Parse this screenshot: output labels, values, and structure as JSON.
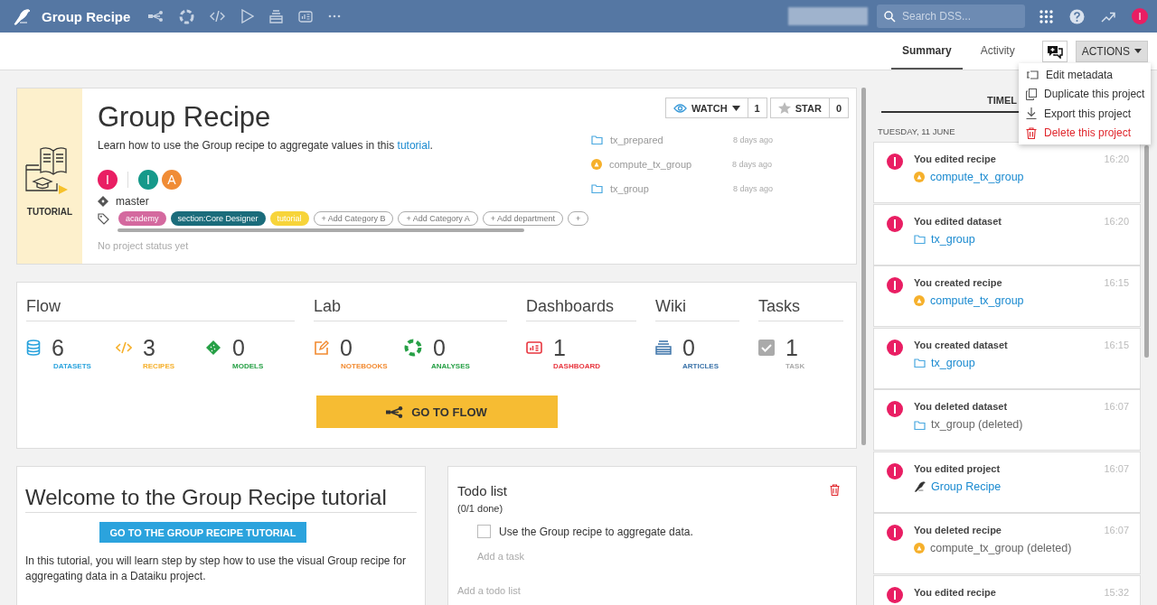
{
  "topbar": {
    "title": "Group Recipe",
    "search": {
      "placeholder": "Search DSS..."
    },
    "avatar": {
      "initial": "I",
      "color": "#e91e63"
    }
  },
  "tabs": [
    {
      "label": "Summary",
      "selected": true
    },
    {
      "label": "Activity",
      "selected": false
    }
  ],
  "actions_button": "ACTIONS",
  "actions_menu": [
    {
      "label": "Edit metadata",
      "kind": "normal"
    },
    {
      "label": "Duplicate this project",
      "kind": "normal"
    },
    {
      "label": "Export this project",
      "kind": "normal"
    },
    {
      "label": "Delete this project",
      "kind": "danger"
    }
  ],
  "project": {
    "badge": "TUTORIAL",
    "title": "Group Recipe",
    "description_before": "Learn how to use the Group recipe to aggregate values in this ",
    "description_link": "tutorial",
    "description_after": ".",
    "owner": {
      "initial": "I",
      "color": "#e91e63"
    },
    "contributors": [
      {
        "initial": "I",
        "color": "#16998a"
      },
      {
        "initial": "A",
        "color": "#f08c36"
      }
    ],
    "branch": "master",
    "tags": [
      {
        "label": "academy",
        "color": "#d4699f"
      },
      {
        "label": "section:Core Designer",
        "color": "#1b6c7b"
      },
      {
        "label": "tutorial",
        "color": "#f7d43a"
      }
    ],
    "add_buttons": [
      "+ Add Category B",
      "+ Add Category A",
      "+ Add department",
      "+"
    ],
    "status": "No project status yet",
    "watch": {
      "label": "WATCH",
      "count": "1"
    },
    "star": {
      "label": "STAR",
      "count": "0"
    },
    "recent": [
      {
        "name": "tx_prepared",
        "kind": "dataset",
        "time": "8 days ago"
      },
      {
        "name": "compute_tx_group",
        "kind": "recipe",
        "time": "8 days ago"
      },
      {
        "name": "tx_group",
        "kind": "dataset",
        "time": "8 days ago"
      }
    ]
  },
  "sections": [
    {
      "title": "Flow",
      "stats": [
        {
          "kind": "datasets",
          "value": "6",
          "label": "DATASETS",
          "color": "#2aa3dd"
        },
        {
          "kind": "recipes",
          "value": "3",
          "label": "RECIPES",
          "color": "#f6b02b"
        },
        {
          "kind": "models",
          "value": "0",
          "label": "MODELS",
          "color": "#27a046"
        }
      ]
    },
    {
      "title": "Lab",
      "stats": [
        {
          "kind": "notebooks",
          "value": "0",
          "label": "NOTEBOOKS",
          "color": "#f28a30"
        },
        {
          "kind": "analyses",
          "value": "0",
          "label": "ANALYSES",
          "color": "#27a046"
        }
      ]
    },
    {
      "title": "Dashboards",
      "stats": [
        {
          "kind": "dashboards",
          "value": "1",
          "label": "DASHBOARD",
          "color": "#e8363f"
        }
      ]
    },
    {
      "title": "Wiki",
      "stats": [
        {
          "kind": "articles",
          "value": "0",
          "label": "ARTICLES",
          "color": "#3a72a8"
        }
      ]
    },
    {
      "title": "Tasks",
      "stats": [
        {
          "kind": "tasks",
          "value": "1",
          "label": "TASK",
          "color": "#aaaaaa"
        }
      ]
    }
  ],
  "go_to_flow": "GO TO FLOW",
  "welcome": {
    "title": "Welcome to the Group Recipe tutorial",
    "button": "GO TO THE GROUP RECIPE TUTORIAL",
    "text": "In this tutorial, you will learn step by step how to use the visual Group recipe for aggregating data in a Dataiku project."
  },
  "todo": {
    "title": "Todo list",
    "progress": "(0/1 done)",
    "items": [
      {
        "label": "Use the Group recipe to aggregate data.",
        "checked": false
      }
    ],
    "add_task": "Add a task",
    "add_list": "Add a todo list"
  },
  "timeline": {
    "tab": "TIMEL",
    "date": "TUESDAY, 11 JUNE",
    "events": [
      {
        "action": "You edited recipe",
        "time": "16:20",
        "object": "compute_tx_group",
        "kind": "recipe",
        "deleted": false
      },
      {
        "action": "You edited dataset",
        "time": "16:20",
        "object": "tx_group",
        "kind": "dataset",
        "deleted": false
      },
      {
        "action": "You created recipe",
        "time": "16:15",
        "object": "compute_tx_group",
        "kind": "recipe",
        "deleted": false
      },
      {
        "action": "You created dataset",
        "time": "16:15",
        "object": "tx_group",
        "kind": "dataset",
        "deleted": false
      },
      {
        "action": "You deleted dataset",
        "time": "16:07",
        "object": "tx_group (deleted)",
        "kind": "dataset",
        "deleted": true
      },
      {
        "action": "You edited project",
        "time": "16:07",
        "object": "Group Recipe",
        "kind": "project",
        "deleted": false
      },
      {
        "action": "You deleted recipe",
        "time": "16:07",
        "object": "compute_tx_group (deleted)",
        "kind": "recipe",
        "deleted": true
      },
      {
        "action": "You edited recipe",
        "time": "15:32"
      }
    ]
  }
}
